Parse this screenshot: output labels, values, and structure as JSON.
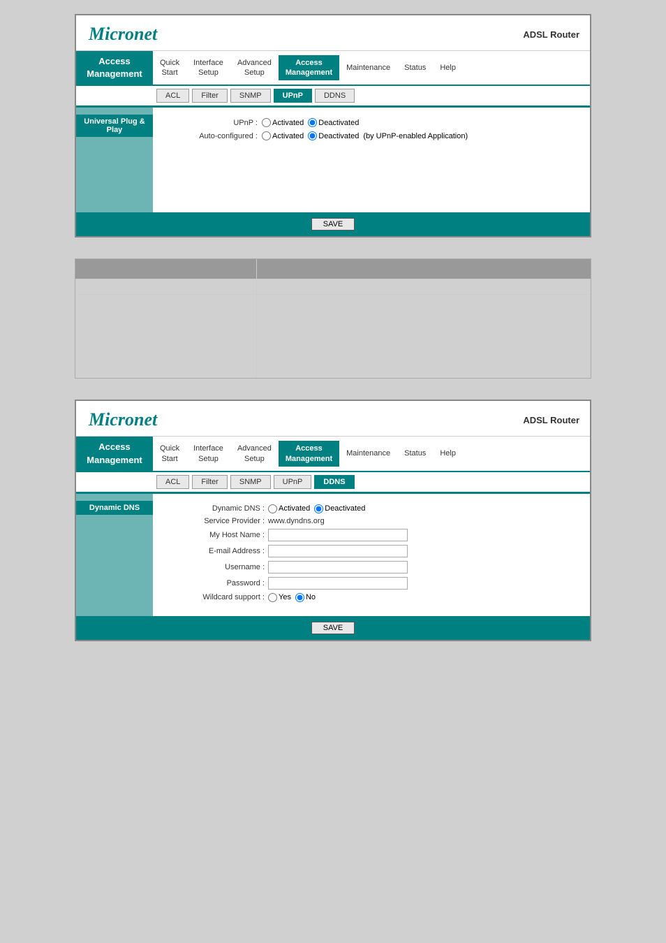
{
  "brand": {
    "logo": "Micronet",
    "product": "ADSL Router"
  },
  "nav": {
    "items": [
      {
        "id": "quick-start",
        "label": "Quick\nStart"
      },
      {
        "id": "interface-setup",
        "label": "Interface\nSetup"
      },
      {
        "id": "advanced-setup",
        "label": "Advanced\nSetup"
      },
      {
        "id": "access-management",
        "label": "Access Management",
        "active": true
      },
      {
        "id": "maintenance",
        "label": "Maintenance"
      },
      {
        "id": "status",
        "label": "Status"
      },
      {
        "id": "help",
        "label": "Help"
      }
    ],
    "sidebar_label": "Access Management"
  },
  "panel1": {
    "sub_tabs": [
      {
        "id": "acl",
        "label": "ACL"
      },
      {
        "id": "filter",
        "label": "Filter"
      },
      {
        "id": "snmp",
        "label": "SNMP"
      },
      {
        "id": "upnp",
        "label": "UPnP",
        "active": true
      },
      {
        "id": "ddns",
        "label": "DDNS"
      }
    ],
    "sidebar_feature": "Universal Plug & Play",
    "upnp_label": "UPnP :",
    "upnp_activated": "Activated",
    "upnp_deactivated": "Deactivated",
    "auto_configured_label": "Auto-configured :",
    "auto_activated": "Activated",
    "auto_deactivated": "Deactivated",
    "auto_note": "(by UPnP-enabled Application)",
    "save_button": "SAVE"
  },
  "panel2": {
    "sub_tabs": [
      {
        "id": "acl",
        "label": "ACL"
      },
      {
        "id": "filter",
        "label": "Filter"
      },
      {
        "id": "snmp",
        "label": "SNMP"
      },
      {
        "id": "upnp",
        "label": "UPnP"
      },
      {
        "id": "ddns",
        "label": "DDNS",
        "active": true
      }
    ],
    "sidebar_feature": "Dynamic DNS",
    "ddns_label": "Dynamic DNS :",
    "ddns_activated": "Activated",
    "ddns_deactivated": "Deactivated",
    "service_provider_label": "Service Provider :",
    "service_provider_value": "www.dyndns.org",
    "host_name_label": "My Host Name :",
    "email_label": "E-mail Address :",
    "username_label": "Username :",
    "password_label": "Password :",
    "wildcard_label": "Wildcard support :",
    "wildcard_yes": "Yes",
    "wildcard_no": "No",
    "save_button": "SAVE"
  },
  "colors": {
    "teal": "#008080",
    "light_teal": "#6db5b5",
    "header_bg": "#ffffff",
    "active_nav": "#008080"
  }
}
